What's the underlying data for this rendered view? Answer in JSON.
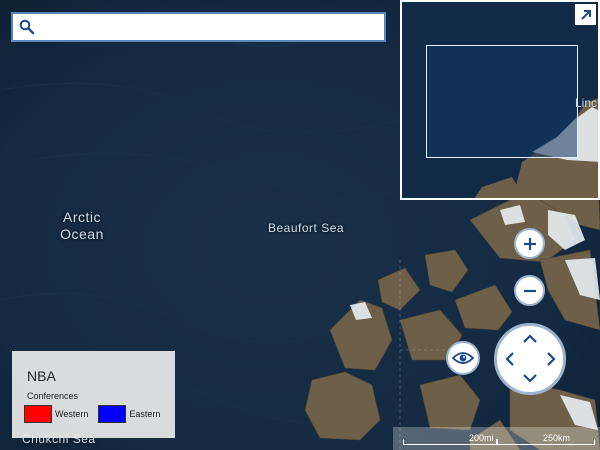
{
  "search": {
    "value": "",
    "placeholder": ""
  },
  "labels": {
    "arctic_line1": "Arctic",
    "arctic_line2": "Ocean",
    "beaufort": "Beaufort Sea",
    "chukchi": "Chukchi Sea",
    "overview_partial": "Linc"
  },
  "legend": {
    "title": "NBA",
    "subtitle": "Conferences",
    "items": [
      {
        "label": "Western",
        "color": "#ff0000"
      },
      {
        "label": "Eastern",
        "color": "#0000ff"
      }
    ]
  },
  "scale": {
    "miles": "200mi",
    "km": "250km"
  },
  "controls": {
    "zoom_in_icon": "plus-icon",
    "zoom_out_icon": "minus-icon",
    "view_icon": "eye-icon",
    "overview_toggle_icon": "arrow-up-right-icon",
    "search_icon": "search-icon"
  },
  "colors": {
    "ocean": "#10253a",
    "land": "#6e6048",
    "ice": "#e8eef2",
    "control_accent": "#1a4a8c"
  }
}
